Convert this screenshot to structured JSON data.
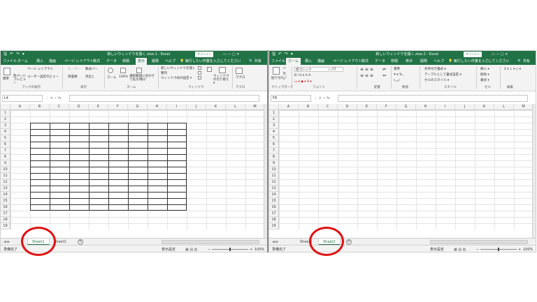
{
  "left": {
    "title": "新しいウィンドウを開く.xlsx:1 - Excel",
    "signin": "サインイン",
    "quick_access": "🖫 ↶ ↷ ▾",
    "window_controls": "▭  —  ▢  ✕",
    "menu": [
      "ファイル",
      "ホーム",
      "挿入",
      "描画",
      "ページ レイアウト",
      "数式",
      "データ",
      "校閲",
      "表示",
      "開発",
      "ヘルプ",
      "💡 実行したい作業を入力してください",
      "🔍 共有"
    ],
    "active_menu_index": 8,
    "ribbon": {
      "views": [
        "標準",
        "改ページプレビュー",
        "ページ レイアウト",
        "ユーザー設定のビュー"
      ],
      "show": [
        "ルーラー",
        "数式バー",
        "目盛線",
        "見出し"
      ],
      "zoom": [
        "ズーム",
        "100%",
        "選択範囲に合わせて拡大/縮小"
      ],
      "window": [
        "新しいウィンドウを開く",
        "整列",
        "ウィンドウ枠の固定 ▾",
        "ウィンドウの切り替え ▾"
      ],
      "macro": "マクロ",
      "groups": [
        "ブックの表示",
        "表示",
        "ズーム",
        "ウィンドウ",
        "マクロ"
      ]
    },
    "name_box": "L4",
    "fx": "⋮  ✕  ✓  fx",
    "columns": [
      "A",
      "B",
      "C",
      "D",
      "E",
      "F",
      "G",
      "H",
      "I",
      "J",
      "K",
      "L",
      "M"
    ],
    "rows": [
      "1",
      "2",
      "3",
      "4",
      "5",
      "6",
      "7",
      "8",
      "9",
      "10",
      "11",
      "12",
      "13",
      "14",
      "15",
      "16",
      "17",
      "18",
      "19"
    ],
    "sheets": [
      "Sheet1",
      "Sheet2"
    ],
    "selected_sheet": "Sheet1",
    "status_ready": "準備完了",
    "status_display": "表示設定",
    "zoom": "100%"
  },
  "right": {
    "title": "新しいウィンドウを開く.xlsx:2 - Excel",
    "signin": "サインイン",
    "quick_access": "🖫 ↶ ↷ ▾",
    "window_controls": "▭  —  ▢  ✕",
    "menu": [
      "ファイル",
      "ホーム",
      "挿入",
      "描画",
      "ページ レイアウト",
      "数式",
      "データ",
      "校閲",
      "表示",
      "開発",
      "ヘルプ",
      "💡 実行したい作業を入力してください",
      "🔍 共有"
    ],
    "active_menu_index": 1,
    "ribbon": {
      "paste": "貼り付け",
      "font_name": "游ゴシック",
      "font_size": "11",
      "font_buttons": "B  I  U  ▾  A  A",
      "number_format": "標準",
      "styles": [
        "条件付き書式 ▾",
        "テーブルとして書式設定 ▾",
        "セルのスタイル ▾"
      ],
      "cells": [
        "挿入 ▾",
        "削除 ▾",
        "書式 ▾"
      ],
      "edit": "Σ ▾  ↓ ▾  ◇ ▾",
      "groups": [
        "クリップボード",
        "フォント",
        "配置",
        "数値",
        "スタイル",
        "セル",
        "編集"
      ]
    },
    "name_box": "F8",
    "fx": "⋮  ✕  ✓  fx",
    "columns": [
      "A",
      "B",
      "C",
      "D",
      "E",
      "F",
      "G",
      "H",
      "I",
      "J",
      "K",
      "L",
      "M"
    ],
    "rows": [
      "1",
      "2",
      "3",
      "4",
      "5",
      "6",
      "7",
      "8",
      "9",
      "10",
      "11",
      "12",
      "13",
      "14",
      "15",
      "16",
      "17",
      "18",
      "19"
    ],
    "sheets": [
      "Sheet1",
      "Sheet2"
    ],
    "selected_sheet": "Sheet2",
    "status_ready": "準備完了",
    "status_display": "表示設定",
    "zoom": "100%"
  },
  "colors": {
    "excel_green": "#217346",
    "highlight_circle": "#e01212"
  }
}
